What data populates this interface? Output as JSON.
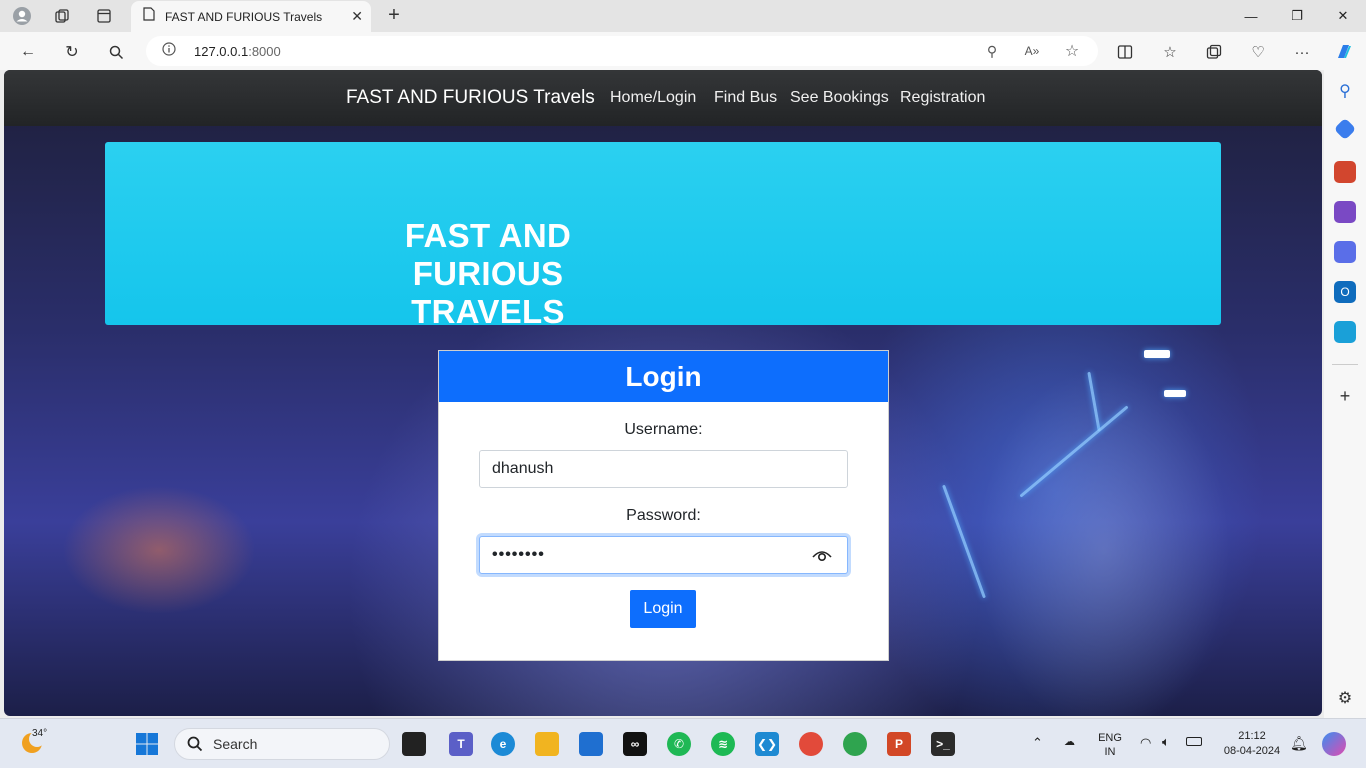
{
  "browser": {
    "tab_title": "FAST AND FURIOUS Travels",
    "url_host": "127.0.0.1",
    "url_port": ":8000"
  },
  "page": {
    "brand": "FAST AND FURIOUS Travels",
    "nav_links": [
      "Home/Login",
      "Find Bus",
      "See Bookings",
      "Registration"
    ],
    "hero_title_line1": "FAST AND FURIOUS",
    "hero_title_line2": "TRAVELS",
    "login": {
      "header": "Login",
      "username_label": "Username:",
      "username_value": "dhanush",
      "password_label": "Password:",
      "password_value": "••••••••",
      "button_label": "Login"
    }
  },
  "taskbar": {
    "weather_temp": "34°",
    "search_placeholder": "Search",
    "language_line1": "ENG",
    "language_line2": "IN",
    "time": "21:12",
    "date": "08-04-2024"
  },
  "colors": {
    "accent_blue": "#0d6efd",
    "hero_cyan": "#1fcbf0",
    "navbar_dark": "#2b2d2f"
  }
}
